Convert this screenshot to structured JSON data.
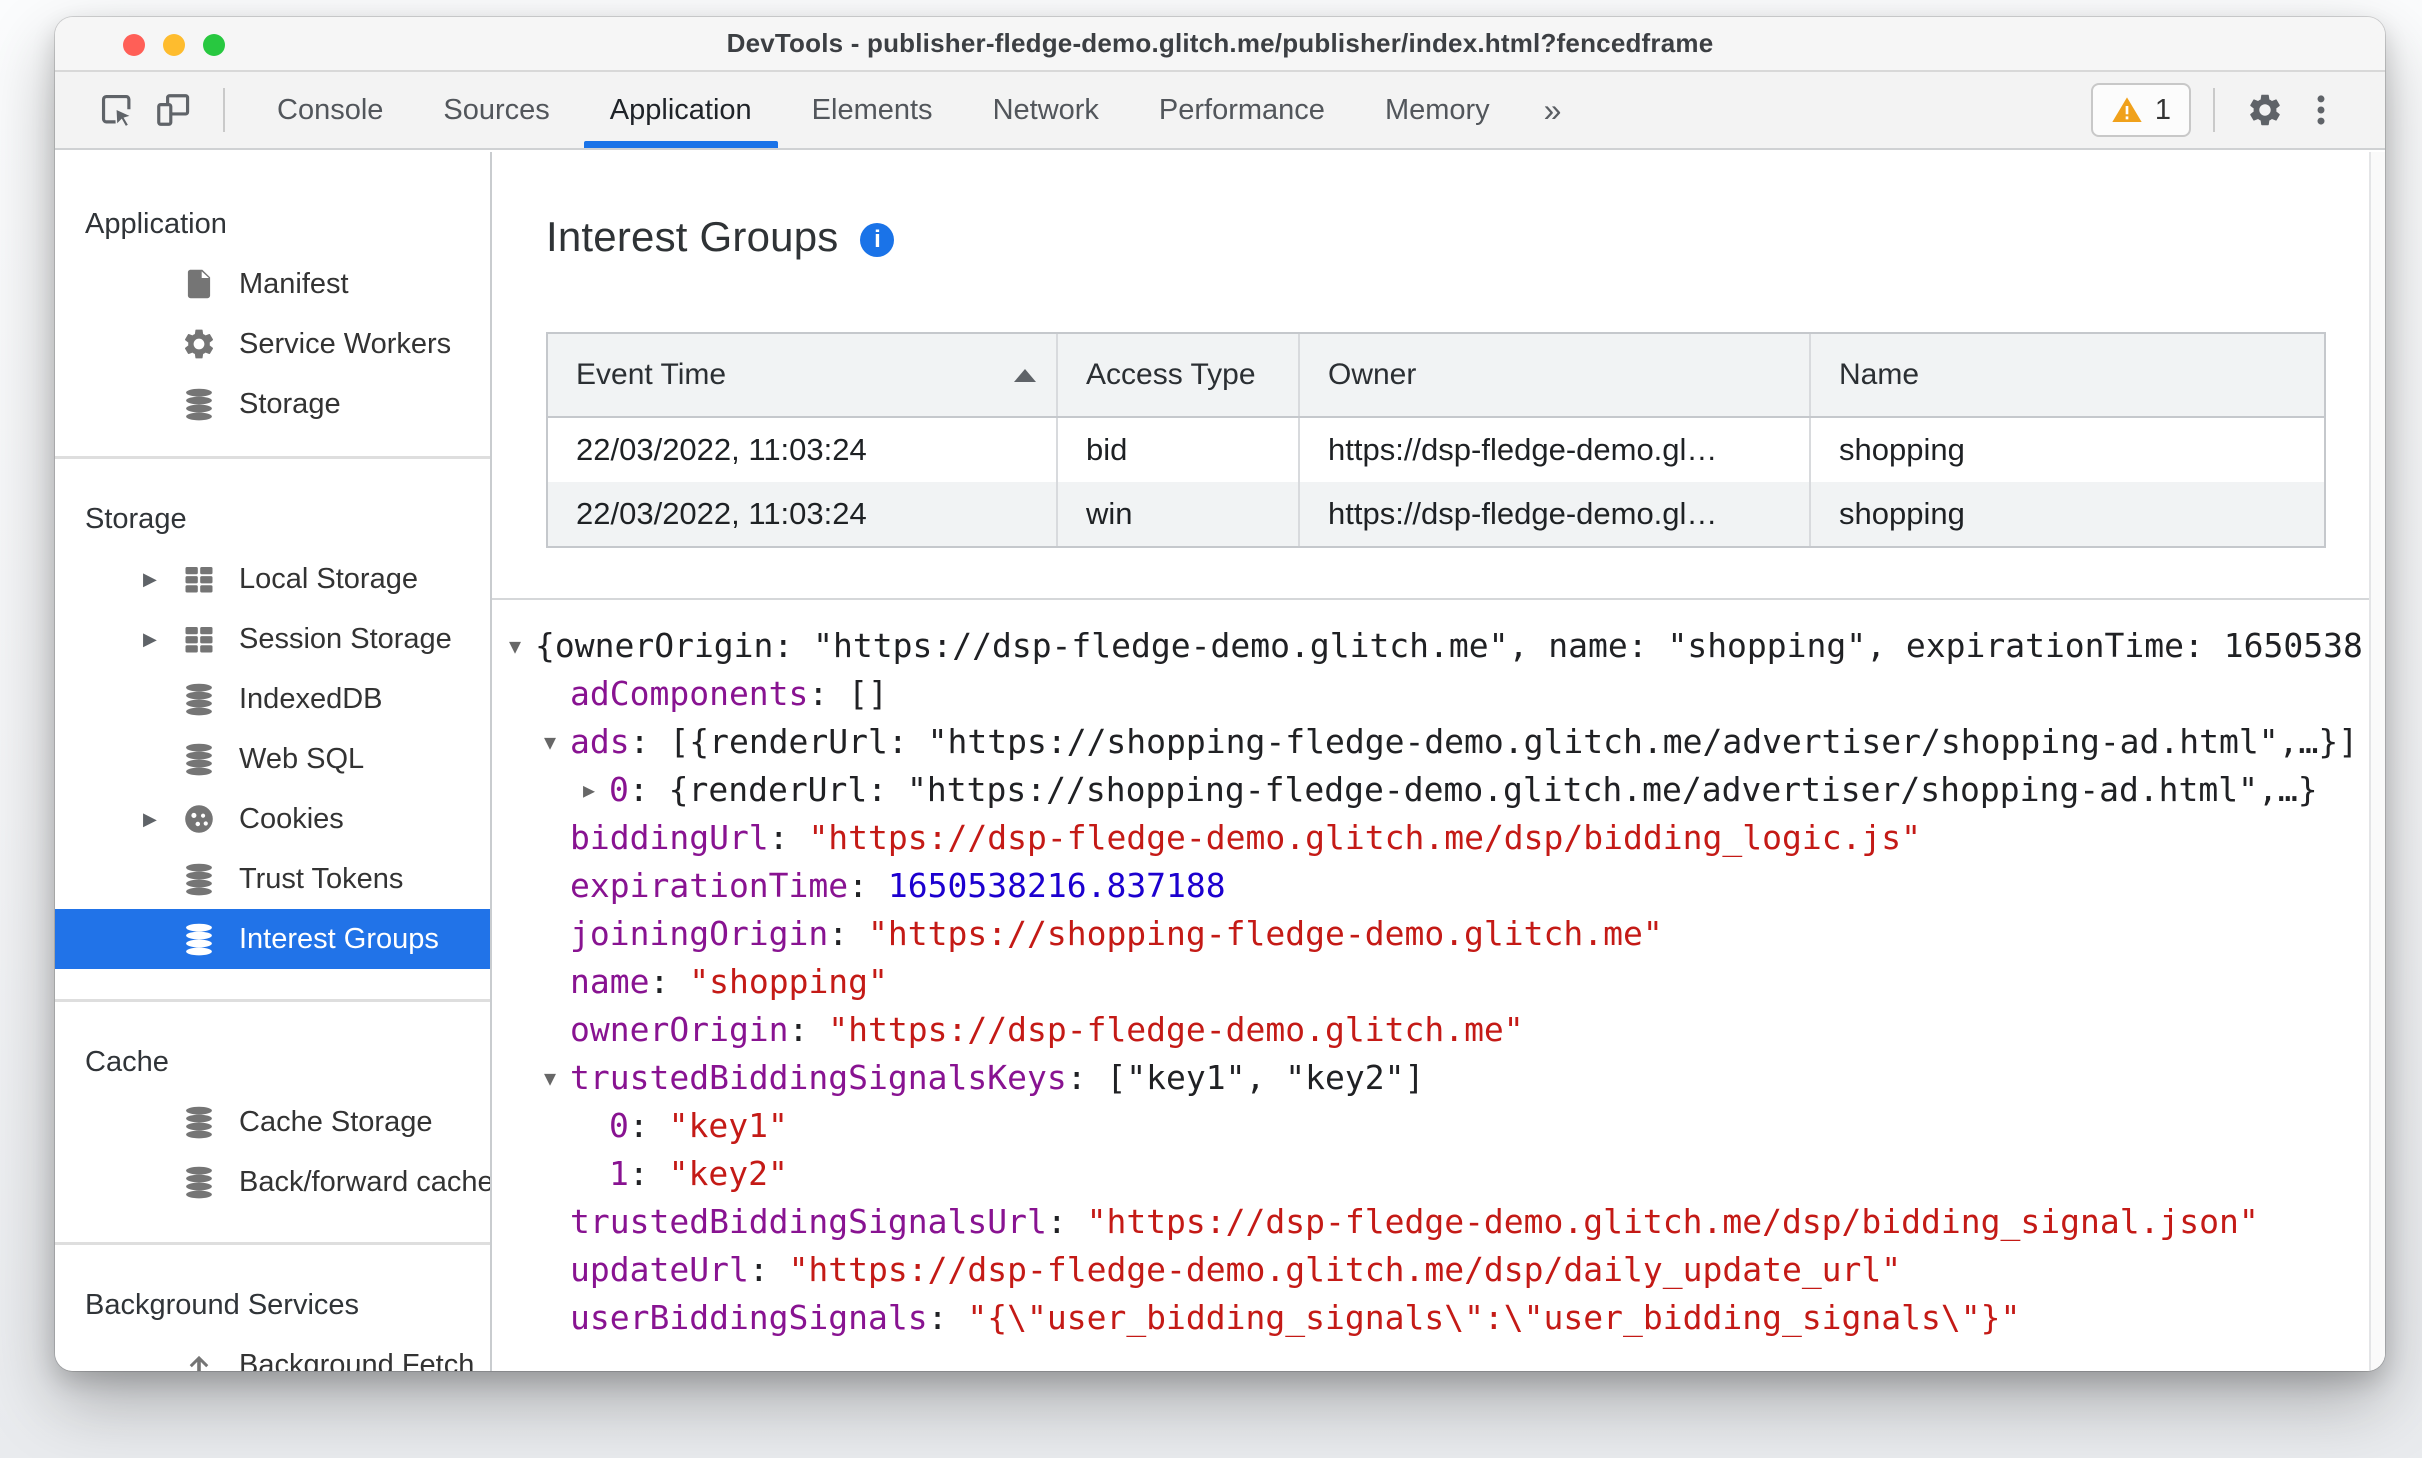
{
  "colors": {
    "accent_blue": "#1a73e8",
    "selection_blue": "#2173e8",
    "key_purple": "#881391",
    "string_red": "#c41a16",
    "number_blue": "#1c00cf",
    "warning_orange": "#f0a11b"
  },
  "window": {
    "title": "DevTools - publisher-fledge-demo.glitch.me/publisher/index.html?fencedframe"
  },
  "toolbar": {
    "tabs": [
      {
        "label": "Console",
        "active": false
      },
      {
        "label": "Sources",
        "active": false
      },
      {
        "label": "Application",
        "active": true
      },
      {
        "label": "Elements",
        "active": false
      },
      {
        "label": "Network",
        "active": false
      },
      {
        "label": "Performance",
        "active": false
      },
      {
        "label": "Memory",
        "active": false
      },
      {
        "label": "»",
        "active": false,
        "more": true
      }
    ],
    "warning_count": "1"
  },
  "sidebar": {
    "sections": [
      {
        "title": "Application",
        "items": [
          {
            "label": "Manifest",
            "icon": "document",
            "expandable": false,
            "selected": false
          },
          {
            "label": "Service Workers",
            "icon": "gear",
            "expandable": false,
            "selected": false
          },
          {
            "label": "Storage",
            "icon": "database",
            "expandable": false,
            "selected": false
          }
        ]
      },
      {
        "title": "Storage",
        "items": [
          {
            "label": "Local Storage",
            "icon": "grid",
            "expandable": true,
            "selected": false
          },
          {
            "label": "Session Storage",
            "icon": "grid",
            "expandable": true,
            "selected": false
          },
          {
            "label": "IndexedDB",
            "icon": "database",
            "expandable": false,
            "selected": false
          },
          {
            "label": "Web SQL",
            "icon": "database",
            "expandable": false,
            "selected": false
          },
          {
            "label": "Cookies",
            "icon": "cookie",
            "expandable": true,
            "selected": false
          },
          {
            "label": "Trust Tokens",
            "icon": "database",
            "expandable": false,
            "selected": false
          },
          {
            "label": "Interest Groups",
            "icon": "database",
            "expandable": false,
            "selected": true
          }
        ]
      },
      {
        "title": "Cache",
        "items": [
          {
            "label": "Cache Storage",
            "icon": "database",
            "expandable": false,
            "selected": false
          },
          {
            "label": "Back/forward cache",
            "icon": "database",
            "expandable": false,
            "selected": false
          }
        ]
      },
      {
        "title": "Background Services",
        "items": [
          {
            "label": "Background Fetch",
            "icon": "fetch",
            "expandable": false,
            "selected": false
          }
        ]
      }
    ]
  },
  "main": {
    "heading": "Interest Groups",
    "info_icon": "i",
    "table": {
      "columns": [
        {
          "label": "Event Time",
          "sorted": "asc"
        },
        {
          "label": "Access Type",
          "sorted": null
        },
        {
          "label": "Owner",
          "sorted": null
        },
        {
          "label": "Name",
          "sorted": null
        }
      ],
      "rows": [
        [
          "22/03/2022, 11:03:24",
          "bid",
          "https://dsp-fledge-demo.gl…",
          "shopping"
        ],
        [
          "22/03/2022, 11:03:24",
          "win",
          "https://dsp-fledge-demo.gl…",
          "shopping"
        ]
      ]
    },
    "tree": {
      "lines": [
        {
          "indent": 0,
          "expander": "down",
          "segments": [
            {
              "text": "{ownerOrigin: \"https://dsp-fledge-demo.glitch.me\", name: \"shopping\", expirationTime: 1650538",
              "type": "plain"
            }
          ]
        },
        {
          "indent": 1,
          "expander": null,
          "segments": [
            {
              "text": "adComponents",
              "type": "key"
            },
            {
              "text": ": []",
              "type": "plain"
            }
          ]
        },
        {
          "indent": 1,
          "expander": "down",
          "segments": [
            {
              "text": "ads",
              "type": "key"
            },
            {
              "text": ": [{renderUrl: \"https://shopping-fledge-demo.glitch.me/advertiser/shopping-ad.html\",…}]",
              "type": "plain"
            }
          ]
        },
        {
          "indent": 2,
          "expander": "right",
          "segments": [
            {
              "text": "0",
              "type": "key"
            },
            {
              "text": ": {renderUrl: \"https://shopping-fledge-demo.glitch.me/advertiser/shopping-ad.html\",…}",
              "type": "plain"
            }
          ]
        },
        {
          "indent": 1,
          "expander": null,
          "segments": [
            {
              "text": "biddingUrl",
              "type": "key"
            },
            {
              "text": ": ",
              "type": "plain"
            },
            {
              "text": "\"https://dsp-fledge-demo.glitch.me/dsp/bidding_logic.js\"",
              "type": "string"
            }
          ]
        },
        {
          "indent": 1,
          "expander": null,
          "segments": [
            {
              "text": "expirationTime",
              "type": "key"
            },
            {
              "text": ": ",
              "type": "plain"
            },
            {
              "text": "1650538216.837188",
              "type": "number"
            }
          ]
        },
        {
          "indent": 1,
          "expander": null,
          "segments": [
            {
              "text": "joiningOrigin",
              "type": "key"
            },
            {
              "text": ": ",
              "type": "plain"
            },
            {
              "text": "\"https://shopping-fledge-demo.glitch.me\"",
              "type": "string"
            }
          ]
        },
        {
          "indent": 1,
          "expander": null,
          "segments": [
            {
              "text": "name",
              "type": "key"
            },
            {
              "text": ": ",
              "type": "plain"
            },
            {
              "text": "\"shopping\"",
              "type": "string"
            }
          ]
        },
        {
          "indent": 1,
          "expander": null,
          "segments": [
            {
              "text": "ownerOrigin",
              "type": "key"
            },
            {
              "text": ": ",
              "type": "plain"
            },
            {
              "text": "\"https://dsp-fledge-demo.glitch.me\"",
              "type": "string"
            }
          ]
        },
        {
          "indent": 1,
          "expander": "down",
          "segments": [
            {
              "text": "trustedBiddingSignalsKeys",
              "type": "key"
            },
            {
              "text": ": [\"key1\", \"key2\"]",
              "type": "plain"
            }
          ]
        },
        {
          "indent": 2,
          "expander": null,
          "segments": [
            {
              "text": "0",
              "type": "key"
            },
            {
              "text": ": ",
              "type": "plain"
            },
            {
              "text": "\"key1\"",
              "type": "string"
            }
          ]
        },
        {
          "indent": 2,
          "expander": null,
          "segments": [
            {
              "text": "1",
              "type": "key"
            },
            {
              "text": ": ",
              "type": "plain"
            },
            {
              "text": "\"key2\"",
              "type": "string"
            }
          ]
        },
        {
          "indent": 1,
          "expander": null,
          "segments": [
            {
              "text": "trustedBiddingSignalsUrl",
              "type": "key"
            },
            {
              "text": ": ",
              "type": "plain"
            },
            {
              "text": "\"https://dsp-fledge-demo.glitch.me/dsp/bidding_signal.json\"",
              "type": "string"
            }
          ]
        },
        {
          "indent": 1,
          "expander": null,
          "segments": [
            {
              "text": "updateUrl",
              "type": "key"
            },
            {
              "text": ": ",
              "type": "plain"
            },
            {
              "text": "\"https://dsp-fledge-demo.glitch.me/dsp/daily_update_url\"",
              "type": "string"
            }
          ]
        },
        {
          "indent": 1,
          "expander": null,
          "segments": [
            {
              "text": "userBiddingSignals",
              "type": "key"
            },
            {
              "text": ": ",
              "type": "plain"
            },
            {
              "text": "\"{\\\"user_bidding_signals\\\":\\\"user_bidding_signals\\\"}\"",
              "type": "string"
            }
          ]
        }
      ]
    }
  }
}
